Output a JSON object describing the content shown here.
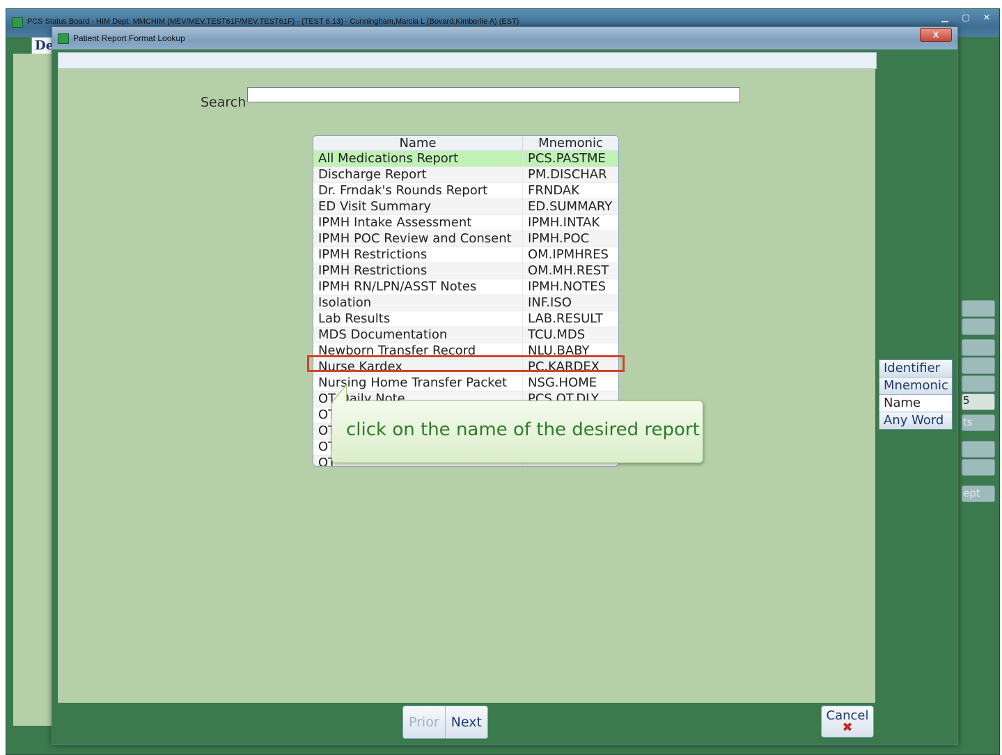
{
  "outer_window": {
    "title": "PCS Status Board - HIM Dept: MMCHIM (MEV/MEV.TEST61F/MEV.TEST61F) - (TEST 6.13) - Cunningham,Marcia L (Bovard,Kimberlie A) (EST)",
    "dept_tab": "Dept",
    "side_fragments": [
      "5",
      "ts",
      "ept"
    ]
  },
  "dialog": {
    "title": "Patient Report Format Lookup",
    "close_label": "X"
  },
  "search": {
    "label": "Search",
    "value": "",
    "placeholder": ""
  },
  "results": {
    "columns": [
      "Name",
      "Mnemonic"
    ],
    "rows": [
      {
        "name": "All Medications Report",
        "mnemonic": "PCS.PASTME"
      },
      {
        "name": "Discharge Report",
        "mnemonic": "PM.DISCHAR"
      },
      {
        "name": "Dr. Frndak's Rounds Report",
        "mnemonic": "FRNDAK"
      },
      {
        "name": "ED Visit Summary",
        "mnemonic": "ED.SUMMARY"
      },
      {
        "name": "IPMH Intake Assessment",
        "mnemonic": "IPMH.INTAK"
      },
      {
        "name": "IPMH POC Review and Consent",
        "mnemonic": "IPMH.POC"
      },
      {
        "name": "IPMH Restrictions",
        "mnemonic": "OM.IPMHRES"
      },
      {
        "name": "IPMH Restrictions",
        "mnemonic": "OM.MH.REST"
      },
      {
        "name": "IPMH RN/LPN/ASST Notes",
        "mnemonic": "IPMH.NOTES"
      },
      {
        "name": "Isolation",
        "mnemonic": "INF.ISO"
      },
      {
        "name": "Lab Results",
        "mnemonic": "LAB.RESULT"
      },
      {
        "name": "MDS Documentation",
        "mnemonic": "TCU.MDS"
      },
      {
        "name": "Newborn Transfer Record",
        "mnemonic": "NLU.BABY"
      },
      {
        "name": "Nurse Kardex",
        "mnemonic": "PC.KARDEX"
      },
      {
        "name": "Nursing Home Transfer Packet",
        "mnemonic": "NSG.HOME"
      },
      {
        "name": "OT Daily Note",
        "mnemonic": "PCS.OT.DLY"
      },
      {
        "name": "OT",
        "mnemonic": ""
      },
      {
        "name": "OT",
        "mnemonic": ""
      },
      {
        "name": "OT",
        "mnemonic": ""
      },
      {
        "name": "OT",
        "mnemonic": ""
      }
    ],
    "selected_index": 0
  },
  "callout": {
    "text": "click on the name of the desired report"
  },
  "search_by": {
    "options": [
      "Identifier",
      "Mnemonic",
      "Name",
      "Any Word"
    ],
    "selected": "Name"
  },
  "footer": {
    "prior_label": "Prior",
    "next_label": "Next",
    "cancel_label": "Cancel",
    "cancel_icon": "✖"
  },
  "colors": {
    "dialog_green": "#3a7a4d",
    "panel_green": "#b5cfa8",
    "selected_row": "#bff2b4",
    "highlight_red": "#d0432a",
    "callout_text": "#2e7d2a"
  }
}
